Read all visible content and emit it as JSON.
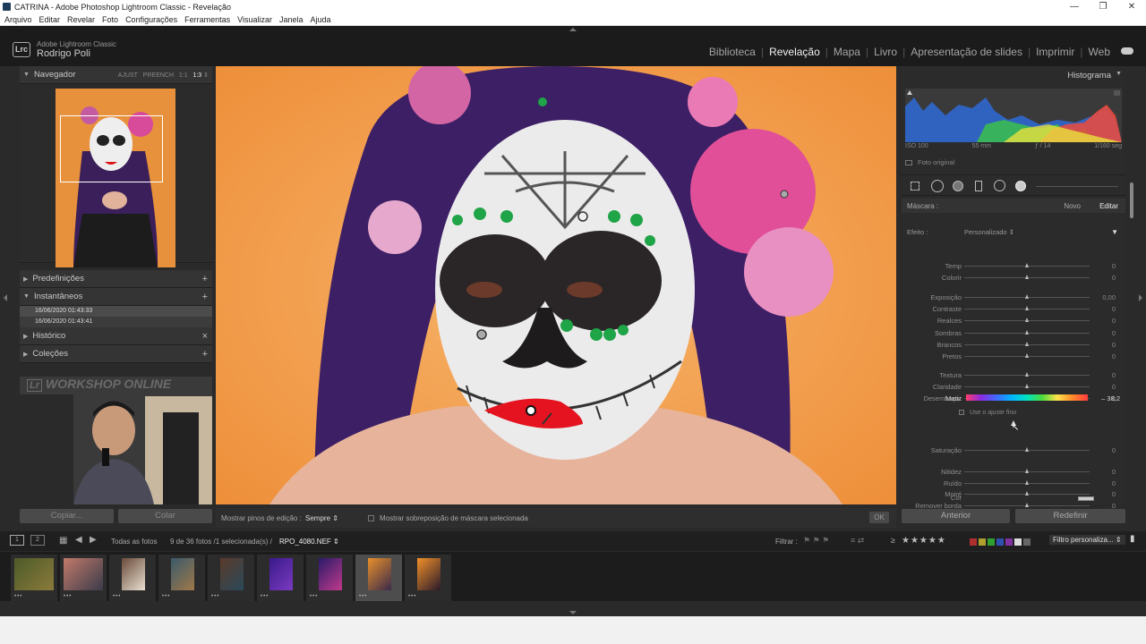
{
  "window": {
    "title": "CATRINA - Adobe Photoshop Lightroom Classic - Revelação",
    "controls": [
      "—",
      "❐",
      "✕"
    ]
  },
  "menu": [
    "Arquivo",
    "Editar",
    "Revelar",
    "Foto",
    "Configurações",
    "Ferramentas",
    "Visualizar",
    "Janela",
    "Ajuda"
  ],
  "identity": {
    "logo": "Lrc",
    "product": "Adobe Lightroom Classic",
    "user": "Rodrigo Poli"
  },
  "modules": [
    {
      "label": "Biblioteca",
      "active": false
    },
    {
      "label": "Revelação",
      "active": true
    },
    {
      "label": "Mapa",
      "active": false
    },
    {
      "label": "Livro",
      "active": false
    },
    {
      "label": "Apresentação de slides",
      "active": false
    },
    {
      "label": "Imprimir",
      "active": false
    },
    {
      "label": "Web",
      "active": false
    }
  ],
  "left_panel": {
    "navigator": {
      "title": "Navegador",
      "options": [
        "AJUST",
        "PREENCH",
        "1:1"
      ],
      "selected_option": "1:3"
    },
    "presets": "Predefinições",
    "snapshots": {
      "title": "Instantâneos",
      "items": [
        "16/06/2020 01:43:33",
        "16/06/2020 01:43:41"
      ]
    },
    "history": "Histórico",
    "collections": "Coleções",
    "webcam_overlay": "WORKSHOP ONLINE",
    "copy_button": "Copiar...",
    "paste_button": "Colar"
  },
  "toolbar": {
    "show_pins_label": "Mostrar pinos de edição :",
    "show_pins_value": "Sempre",
    "overlay_label": "Mostrar sobreposição de máscara selecionada",
    "ok": "OK"
  },
  "right_panel": {
    "histogram_title": "Histograma",
    "histogram_meta": [
      "ISO 100",
      "55 mm",
      "ƒ / 14",
      "1/160 seg"
    ],
    "original_photo": "Foto original",
    "mask_label": "Máscara :",
    "mask_new": "Novo",
    "mask_edit": "Editar",
    "effect_label": "Efeito :",
    "effect_value": "Personalizado",
    "sliders": [
      {
        "name": "Temp",
        "value": "0",
        "pos": 0.5
      },
      {
        "name": "Colorir",
        "value": "0",
        "pos": 0.5
      },
      {
        "name": "Exposição",
        "value": "0,00",
        "pos": 0.5
      },
      {
        "name": "Contraste",
        "value": "0",
        "pos": 0.5
      },
      {
        "name": "Realces",
        "value": "0",
        "pos": 0.5
      },
      {
        "name": "Sombras",
        "value": "0",
        "pos": 0.5
      },
      {
        "name": "Brancos",
        "value": "0",
        "pos": 0.5
      },
      {
        "name": "Pretos",
        "value": "0",
        "pos": 0.5
      },
      {
        "name": "Textura",
        "value": "0",
        "pos": 0.5
      },
      {
        "name": "Claridade",
        "value": "0",
        "pos": 0.5
      },
      {
        "name": "Desembaçar",
        "value": "0",
        "pos": 0.5
      }
    ],
    "hue": {
      "name": "Matiz",
      "value": "– 38,2",
      "pos": 0.39
    },
    "fine_adjust": "Use o ajuste fino",
    "sliders2": [
      {
        "name": "Saturação",
        "value": "0",
        "pos": 0.5
      },
      {
        "name": "Nitidez",
        "value": "0",
        "pos": 0.5
      },
      {
        "name": "Ruído",
        "value": "0",
        "pos": 0.5
      },
      {
        "name": "Moiré",
        "value": "0",
        "pos": 0.5
      },
      {
        "name": "Remover borda",
        "value": "0",
        "pos": 0.5
      }
    ],
    "color_label": "Cor",
    "previous_button": "Anterior",
    "reset_button": "Redefinir"
  },
  "filmstrip_bar": {
    "view1": "1",
    "view2": "2",
    "source": "Todas as fotos",
    "count": "9 de 36 fotos /1 selecionada(s) /",
    "filename": "RPO_4080.NEF",
    "filter_label": "Filtrar :",
    "rating_op": "≥",
    "filter_preset": "Filtro personaliza..."
  },
  "thumbnails": [
    {
      "colors": [
        "#4d5b2a",
        "#8a7a3a"
      ],
      "selected": false
    },
    {
      "colors": [
        "#c27a6a",
        "#3b3b4a"
      ],
      "selected": false
    },
    {
      "colors": [
        "#6a4a3a",
        "#e8e0d0"
      ],
      "selected": false
    },
    {
      "colors": [
        "#3a5a6a",
        "#a0784a"
      ],
      "selected": false
    },
    {
      "colors": [
        "#5a3a2a",
        "#2a4a5a"
      ],
      "selected": false
    },
    {
      "colors": [
        "#3a1a8a",
        "#7a3ac0"
      ],
      "selected": false
    },
    {
      "colors": [
        "#2a1a6a",
        "#c03a8a"
      ],
      "selected": false
    },
    {
      "colors": [
        "#e8902a",
        "#3a2a4a"
      ],
      "selected": true
    },
    {
      "colors": [
        "#f0902a",
        "#2a1a2a"
      ],
      "selected": false
    }
  ],
  "color_swatches": [
    "#b03030",
    "#b0a030",
    "#30a030",
    "#3050b0",
    "#8030a0",
    "#dddddd",
    "#666666"
  ]
}
